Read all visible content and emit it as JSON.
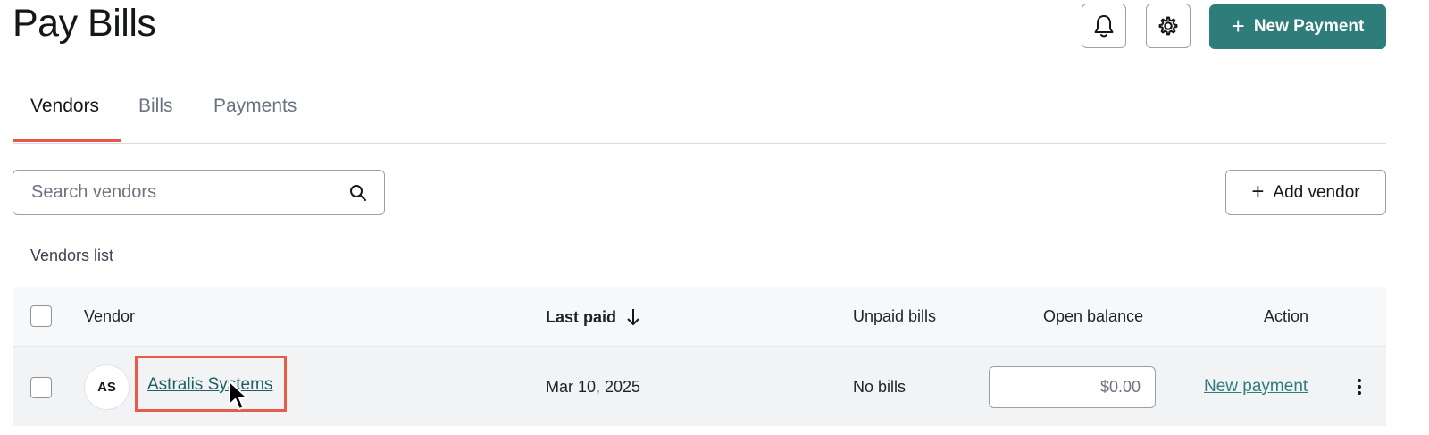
{
  "header": {
    "title": "Pay Bills",
    "new_payment_label": "New Payment",
    "new_payment_icon": "plus-icon",
    "notifications_icon": "bell-icon",
    "settings_icon": "gear-icon"
  },
  "tabs": [
    {
      "label": "Vendors",
      "active": true
    },
    {
      "label": "Bills",
      "active": false
    },
    {
      "label": "Payments",
      "active": false
    }
  ],
  "search": {
    "placeholder": "Search vendors",
    "value": "",
    "icon": "search-icon"
  },
  "add_vendor": {
    "label": "Add vendor",
    "icon": "plus-icon"
  },
  "vendors_list": {
    "label": "Vendors list",
    "columns": {
      "vendor": "Vendor",
      "last_paid": "Last paid",
      "unpaid_bills": "Unpaid bills",
      "open_balance": "Open balance",
      "action": "Action"
    },
    "sort_icon": "arrow-down-icon",
    "rows": [
      {
        "initials": "AS",
        "vendor": "Astralis Systems",
        "last_paid": "Mar 10, 2025",
        "unpaid_bills": "No bills",
        "open_balance_placeholder": "$0.00",
        "action": "New payment"
      }
    ]
  },
  "colors": {
    "primary": "#2f7d7b",
    "tab_indicator": "#e6574a",
    "highlight": "#e85a4a"
  }
}
